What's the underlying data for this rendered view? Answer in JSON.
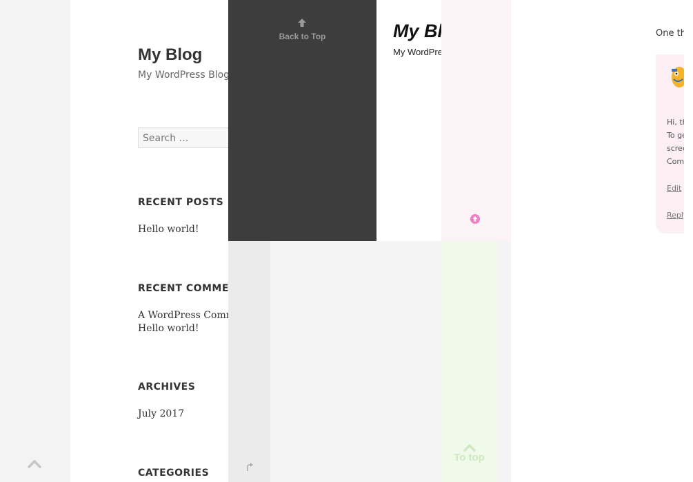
{
  "left_blog": {
    "site_title": "My Blog",
    "site_description": "My WordPress Blog",
    "search_placeholder": "Search …",
    "recent_posts": {
      "title": "RECENT POSTS",
      "items": [
        "Hello world!"
      ]
    },
    "recent_comments": {
      "title": "RECENT COMMENTS",
      "author": "A WordPress Commenter",
      "post": "Hello world!"
    },
    "archives": {
      "title": "ARCHIVES",
      "items": [
        "July 2017"
      ]
    },
    "categories": {
      "title": "CATEGORIES"
    }
  },
  "dark_panel": {
    "back_to_top_label": "Back to Top",
    "icon": "arrow-up-icon"
  },
  "white_panel": {
    "site_title": "My Bl",
    "site_description": "My WordPre"
  },
  "pink_panel": {
    "icon": "circle-arrow-up-icon",
    "accent": "#ee7fc3"
  },
  "green_panel": {
    "to_top_label": "To top",
    "icon": "chevron-up-icon",
    "accent": "#cde9c1"
  },
  "lower_left": {
    "icon": "small-arrow-up-icon"
  },
  "left_scroll": {
    "icon": "chevron-up-icon"
  },
  "right_panel": {
    "intro_text": "One th",
    "comment": {
      "lines": [
        "Hi, th",
        "To ge",
        "scree",
        "Com"
      ],
      "edit_label": "Edit",
      "reply_label": "Reply"
    }
  }
}
